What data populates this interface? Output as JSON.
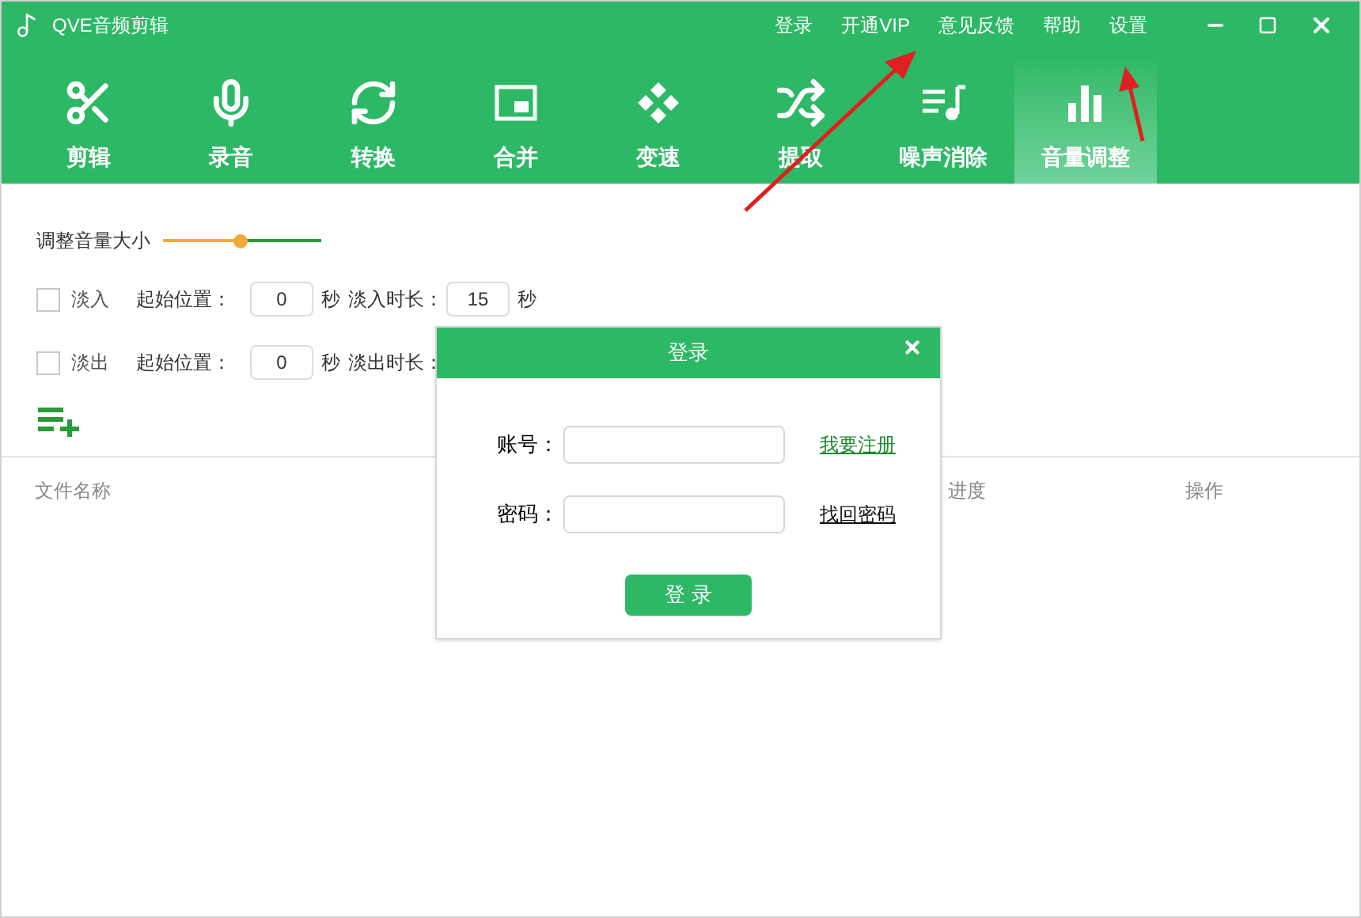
{
  "window": {
    "title": "QVE音频剪辑"
  },
  "top_menu": [
    "登录",
    "开通VIP",
    "意见反馈",
    "帮助",
    "设置"
  ],
  "tabs": [
    {
      "label": "剪辑",
      "selected": false
    },
    {
      "label": "录音",
      "selected": false
    },
    {
      "label": "转换",
      "selected": false
    },
    {
      "label": "合并",
      "selected": false
    },
    {
      "label": "变速",
      "selected": false
    },
    {
      "label": "提取",
      "selected": false
    },
    {
      "label": "噪声消除",
      "selected": false
    },
    {
      "label": "音量调整",
      "selected": true
    }
  ],
  "volume": {
    "label": "调整音量大小",
    "level": 0.49
  },
  "fades": [
    {
      "label": "淡入",
      "checked": false,
      "start_label": "起始位置：",
      "start_value": "0",
      "unit": "秒",
      "duration_label": "淡入时长：",
      "duration_value": "15",
      "duration_unit": "秒"
    },
    {
      "label": "淡出",
      "checked": false,
      "start_label": "起始位置：",
      "start_value": "0",
      "unit": "秒",
      "duration_label": "淡出时长："
    }
  ],
  "table": {
    "columns": [
      "文件名称",
      "进度",
      "操作"
    ]
  },
  "dialog": {
    "title": "登录",
    "fields": [
      {
        "label": "账号：",
        "link": "我要注册",
        "color": "#1e8a2e"
      },
      {
        "label": "密码：",
        "link": "找回密码",
        "color": "#111111"
      }
    ],
    "button": "登 录"
  }
}
